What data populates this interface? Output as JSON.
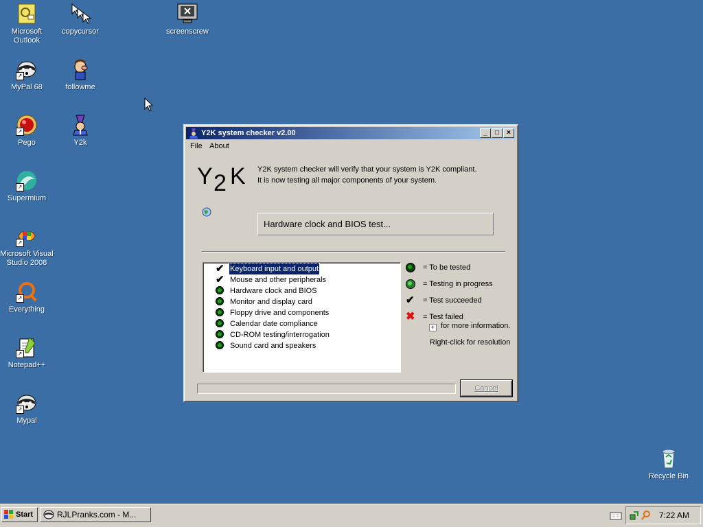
{
  "desktop": {
    "icons": [
      {
        "label": "Microsoft Outlook",
        "icon": "outlook-icon"
      },
      {
        "label": "copycursor",
        "icon": "cursor-icon"
      },
      {
        "label": "screenscrew",
        "icon": "screenscrew-icon"
      },
      {
        "label": "MyPal 68",
        "icon": "raccoon-icon"
      },
      {
        "label": "followme",
        "icon": "character-icon"
      },
      {
        "label": "Pego",
        "icon": "red-orb-icon"
      },
      {
        "label": "Y2k",
        "icon": "wizard-icon"
      },
      {
        "label": "Supermium",
        "icon": "supermium-icon"
      },
      {
        "label": "Microsoft Visual Studio 2008",
        "icon": "visual-studio-icon"
      },
      {
        "label": "Everything",
        "icon": "everything-icon"
      },
      {
        "label": "Notepad++",
        "icon": "notepadpp-icon"
      },
      {
        "label": "Mypal",
        "icon": "raccoon-icon"
      },
      {
        "label": "Recycle Bin",
        "icon": "recycle-bin-icon"
      }
    ]
  },
  "window": {
    "title": "Y2K system checker v2.00",
    "controls": {
      "minimize": "_",
      "maximize": "□",
      "close": "×"
    },
    "menu": {
      "file": "File",
      "about": "About"
    },
    "logo": {
      "y": "Y",
      "two": "2",
      "k": "K"
    },
    "intro_line1": "Y2K system checker will verify that your system is Y2K compliant.",
    "intro_line2": "It is now testing all major components of your system.",
    "current_test": "Hardware clock and BIOS test...",
    "tests": [
      {
        "label": "Keyboard input and output",
        "status": "succeeded",
        "selected": true
      },
      {
        "label": "Mouse and other peripherals",
        "status": "succeeded"
      },
      {
        "label": "Hardware clock and BIOS",
        "status": "to-be-tested"
      },
      {
        "label": "Monitor and display card",
        "status": "to-be-tested"
      },
      {
        "label": "Floppy drive and components",
        "status": "to-be-tested"
      },
      {
        "label": "Calendar date compliance",
        "status": "to-be-tested"
      },
      {
        "label": "CD-ROM testing/interrogation",
        "status": "to-be-tested"
      },
      {
        "label": "Sound card and speakers",
        "status": "to-be-tested"
      }
    ],
    "legend": {
      "to_be_tested": "= To be tested",
      "in_progress": "= Testing in progress",
      "succeeded": "= Test succeeded",
      "failed": "= Test failed",
      "more_info": "for more information.",
      "plus": "+",
      "right_click": "Right-click for resolution"
    },
    "progress": 0,
    "cancel_label": "Cancel"
  },
  "taskbar": {
    "start_label": "Start",
    "task_label": "RJLPranks.com - M...",
    "clock": "7:22 AM"
  },
  "colors": {
    "desktop": "#3a6ea5",
    "titlebar_start": "#0a246a",
    "titlebar_end": "#a6caf0",
    "face": "#d4d0c8",
    "status_green": "#19a019",
    "failed_red": "#e01010"
  }
}
